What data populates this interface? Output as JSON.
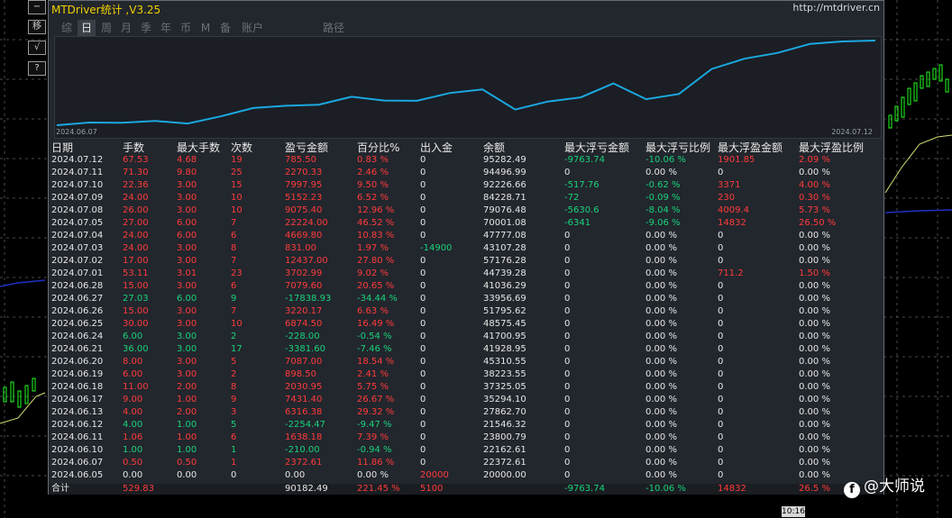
{
  "window": {
    "title": "MTDriver统计 ,V3.25",
    "link": "http://mtdriver.cn"
  },
  "side_buttons": [
    "−",
    "移",
    "√",
    "?"
  ],
  "tabs": [
    "综",
    "日",
    "周",
    "月",
    "季",
    "年",
    "币",
    "M",
    "备",
    "账户",
    "路径"
  ],
  "active_tab": "日",
  "equity_chart": {
    "start_label": "2024.06.07",
    "end_label": "2024.07.12",
    "dates": [
      "2024.06.05",
      "2024.06.07",
      "2024.06.10",
      "2024.06.11",
      "2024.06.12",
      "2024.06.13",
      "2024.06.17",
      "2024.06.18",
      "2024.06.19",
      "2024.06.20",
      "2024.06.21",
      "2024.06.24",
      "2024.06.25",
      "2024.06.26",
      "2024.06.27",
      "2024.06.28",
      "2024.07.01",
      "2024.07.02",
      "2024.07.03",
      "2024.07.04",
      "2024.07.05",
      "2024.07.08",
      "2024.07.09",
      "2024.07.10",
      "2024.07.11",
      "2024.07.12"
    ],
    "balance": [
      20000.0,
      22372.61,
      22162.61,
      23800.79,
      21546.32,
      27862.7,
      35294.1,
      37325.05,
      38223.55,
      45310.55,
      41928.95,
      41700.95,
      48575.45,
      51795.62,
      33956.69,
      41036.29,
      44739.28,
      57176.28,
      43107.28,
      47777.08,
      70001.08,
      79076.48,
      84228.71,
      92226.66,
      94496.99,
      95282.49
    ],
    "line_color": "#1ba8e0"
  },
  "columns": [
    "日期",
    "手数",
    "最大手数",
    "次数",
    "盈亏金额",
    "百分比%",
    "出入金",
    "余额",
    "最大浮亏金额",
    "最大浮亏比例",
    "最大浮盈金额",
    "最大浮盈比例"
  ],
  "rows": [
    [
      "2024.07.12",
      "67.53",
      "4.68",
      "19",
      "785.50",
      "0.83 %",
      "0",
      "95282.49",
      "-9763.74",
      "-10.06 %",
      "1901.85",
      "2.09 %"
    ],
    [
      "2024.07.11",
      "71.30",
      "9.80",
      "25",
      "2270.33",
      "2.46 %",
      "0",
      "94496.99",
      "0",
      "0.00 %",
      "0",
      "0.00 %"
    ],
    [
      "2024.07.10",
      "22.36",
      "3.00",
      "15",
      "7997.95",
      "9.50 %",
      "0",
      "92226.66",
      "-517.76",
      "-0.62 %",
      "3371",
      "4.00 %"
    ],
    [
      "2024.07.09",
      "24.00",
      "3.00",
      "10",
      "5152.23",
      "6.52 %",
      "0",
      "84228.71",
      "-72",
      "-0.09 %",
      "230",
      "0.30 %"
    ],
    [
      "2024.07.08",
      "26.00",
      "3.00",
      "10",
      "9075.40",
      "12.96 %",
      "0",
      "79076.48",
      "-5630.6",
      "-8.04 %",
      "4009.4",
      "5.73 %"
    ],
    [
      "2024.07.05",
      "27.00",
      "6.00",
      "7",
      "22224.00",
      "46.52 %",
      "0",
      "70001.08",
      "-6341",
      "-9.06 %",
      "14832",
      "26.50 %"
    ],
    [
      "2024.07.04",
      "24.00",
      "6.00",
      "6",
      "4669.80",
      "10.83 %",
      "0",
      "47777.08",
      "0",
      "0.00 %",
      "0",
      "0.00 %"
    ],
    [
      "2024.07.03",
      "24.00",
      "3.00",
      "8",
      "831.00",
      "1.97 %",
      "-14900",
      "43107.28",
      "0",
      "0.00 %",
      "0",
      "0.00 %"
    ],
    [
      "2024.07.02",
      "17.00",
      "3.00",
      "7",
      "12437.00",
      "27.80 %",
      "0",
      "57176.28",
      "0",
      "0.00 %",
      "0",
      "0.00 %"
    ],
    [
      "2024.07.01",
      "53.11",
      "3.01",
      "23",
      "3702.99",
      "9.02 %",
      "0",
      "44739.28",
      "0",
      "0.00 %",
      "711.2",
      "1.50 %"
    ],
    [
      "2024.06.28",
      "15.00",
      "3.00",
      "6",
      "7079.60",
      "20.65 %",
      "0",
      "41036.29",
      "0",
      "0.00 %",
      "0",
      "0.00 %"
    ],
    [
      "2024.06.27",
      "27.03",
      "6.00",
      "9",
      "-17838.93",
      "-34.44 %",
      "0",
      "33956.69",
      "0",
      "0.00 %",
      "0",
      "0.00 %"
    ],
    [
      "2024.06.26",
      "15.00",
      "3.00",
      "7",
      "3220.17",
      "6.63 %",
      "0",
      "51795.62",
      "0",
      "0.00 %",
      "0",
      "0.00 %"
    ],
    [
      "2024.06.25",
      "30.00",
      "3.00",
      "10",
      "6874.50",
      "16.49 %",
      "0",
      "48575.45",
      "0",
      "0.00 %",
      "0",
      "0.00 %"
    ],
    [
      "2024.06.24",
      "6.00",
      "3.00",
      "2",
      "-228.00",
      "-0.54 %",
      "0",
      "41700.95",
      "0",
      "0.00 %",
      "0",
      "0.00 %"
    ],
    [
      "2024.06.21",
      "36.00",
      "3.00",
      "17",
      "-3381.60",
      "-7.46 %",
      "0",
      "41928.95",
      "0",
      "0.00 %",
      "0",
      "0.00 %"
    ],
    [
      "2024.06.20",
      "8.00",
      "3.00",
      "5",
      "7087.00",
      "18.54 %",
      "0",
      "45310.55",
      "0",
      "0.00 %",
      "0",
      "0.00 %"
    ],
    [
      "2024.06.19",
      "6.00",
      "3.00",
      "2",
      "898.50",
      "2.41 %",
      "0",
      "38223.55",
      "0",
      "0.00 %",
      "0",
      "0.00 %"
    ],
    [
      "2024.06.18",
      "11.00",
      "2.00",
      "8",
      "2030.95",
      "5.75 %",
      "0",
      "37325.05",
      "0",
      "0.00 %",
      "0",
      "0.00 %"
    ],
    [
      "2024.06.17",
      "9.00",
      "1.00",
      "9",
      "7431.40",
      "26.67 %",
      "0",
      "35294.10",
      "0",
      "0.00 %",
      "0",
      "0.00 %"
    ],
    [
      "2024.06.13",
      "4.00",
      "2.00",
      "3",
      "6316.38",
      "29.32 %",
      "0",
      "27862.70",
      "0",
      "0.00 %",
      "0",
      "0.00 %"
    ],
    [
      "2024.06.12",
      "4.00",
      "1.00",
      "5",
      "-2254.47",
      "-9.47 %",
      "0",
      "21546.32",
      "0",
      "0.00 %",
      "0",
      "0.00 %"
    ],
    [
      "2024.06.11",
      "1.06",
      "1.00",
      "6",
      "1638.18",
      "7.39 %",
      "0",
      "23800.79",
      "0",
      "0.00 %",
      "0",
      "0.00 %"
    ],
    [
      "2024.06.10",
      "1.00",
      "1.00",
      "1",
      "-210.00",
      "-0.94 %",
      "0",
      "22162.61",
      "0",
      "0.00 %",
      "0",
      "0.00 %"
    ],
    [
      "2024.06.07",
      "0.50",
      "0.50",
      "1",
      "2372.61",
      "11.86 %",
      "0",
      "22372.61",
      "0",
      "0.00 %",
      "0",
      "0.00 %"
    ],
    [
      "2024.06.05",
      "0.00",
      "0.00",
      "0",
      "0.00",
      "0.00 %",
      "20000",
      "20000.00",
      "0",
      "0.00 %",
      "0",
      "0.00 %"
    ]
  ],
  "totals": {
    "label": "合计",
    "lots": "529.83",
    "pnl": "90182.49",
    "pct": "221.45 %",
    "deposit": "5100",
    "max_float_loss": "-9763.74",
    "max_float_loss_pct": "-10.06 %",
    "max_float_profit": "14832",
    "max_float_profit_pct": "26.5 %"
  },
  "watermark": "@大师说",
  "clock": "10:16",
  "colors": {
    "profit": "#ff3b3b",
    "loss": "#19d37a",
    "neutral": "#e6e6e6",
    "title": "#f0d000"
  }
}
